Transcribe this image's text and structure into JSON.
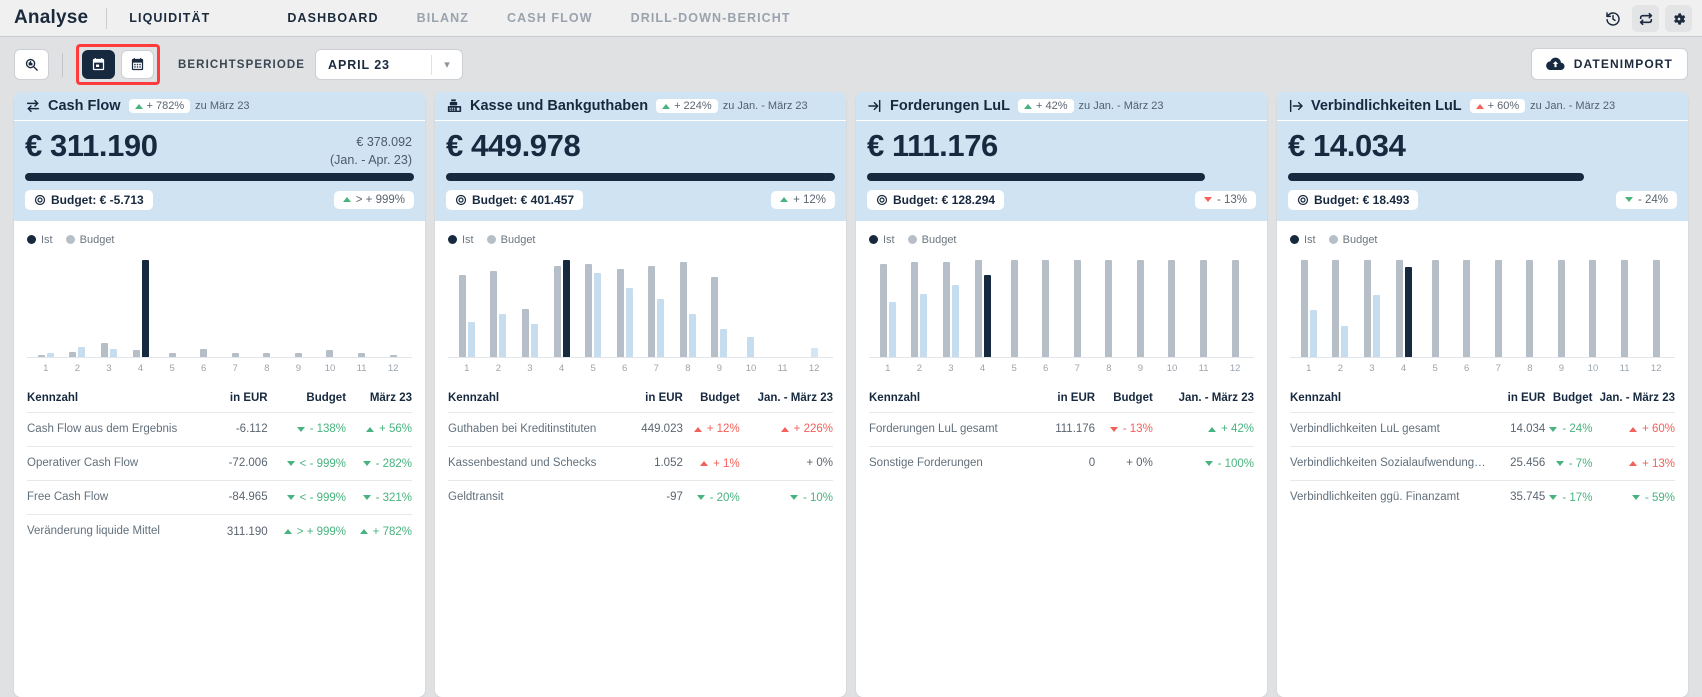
{
  "topbar": {
    "app_title": "Analyse",
    "module": "LIQUIDITÄT",
    "tabs": [
      {
        "label": "DASHBOARD",
        "active": true
      },
      {
        "label": "BILANZ",
        "active": false
      },
      {
        "label": "CASH FLOW",
        "active": false
      },
      {
        "label": "DRILL-DOWN-BERICHT",
        "active": false
      }
    ],
    "icons": [
      "history-icon",
      "refresh-icon",
      "gear-icon"
    ]
  },
  "toolbar": {
    "search_icon": "search-zoom-icon",
    "view_month_icon": "calendar-day-icon",
    "view_year_icon": "calendar-grid-icon",
    "period_label": "BERICHTSPERIODE",
    "period_value": "APRIL 23",
    "import_label": "DATENIMPORT",
    "import_icon": "cloud-upload-icon",
    "highlight_color": "#ff3b3b"
  },
  "table_headers": {
    "kennzahl": "Kennzahl",
    "in_eur": "in EUR",
    "budget": "Budget"
  },
  "cards": [
    {
      "icon": "transfer-arrows-icon",
      "title": "Cash Flow",
      "hdr_delta": "+ 782%",
      "hdr_delta_dir": "up",
      "hdr_note": "zu März 23",
      "big_value": "€ 311.190",
      "sub_value_1": "€ 378.092",
      "sub_value_2": "(Jan. - Apr. 23)",
      "bar_pct": 100,
      "budget_pill": "Budget: € -5.713",
      "delta_pill": "> + 999%",
      "delta_pill_dir": "up",
      "legend": [
        "Ist",
        "Budget"
      ],
      "col4": "März 23",
      "rows": [
        {
          "name": "Cash Flow aus dem Ergebnis",
          "eur": "-6.112",
          "budget": "- 138%",
          "budget_dir": "down",
          "c4": "+ 56%",
          "c4_dir": "up"
        },
        {
          "name": "Operativer Cash Flow",
          "eur": "-72.006",
          "budget": "< - 999%",
          "budget_dir": "down",
          "c4": "- 282%",
          "c4_dir": "down"
        },
        {
          "name": "Free Cash Flow",
          "eur": "-84.965",
          "budget": "< - 999%",
          "budget_dir": "down",
          "c4": "- 321%",
          "c4_dir": "down"
        },
        {
          "name": "Veränderung liquide Mittel",
          "eur": "311.190",
          "budget": "> + 999%",
          "budget_dir": "up",
          "c4": "+ 782%",
          "c4_dir": "up"
        }
      ],
      "chart_data": {
        "type": "bar",
        "title": "Cash Flow",
        "categories": [
          "1",
          "2",
          "3",
          "4",
          "5",
          "6",
          "7",
          "8",
          "9",
          "10",
          "11",
          "12"
        ],
        "series": [
          {
            "name": "Ist",
            "values": [
              2,
              6,
              5,
              62,
              0,
              0,
              0,
              0,
              0,
              0,
              0,
              0
            ]
          },
          {
            "name": "Budget",
            "values": [
              1,
              3,
              9,
              4,
              2,
              5,
              2,
              2,
              2,
              4,
              2,
              1
            ]
          }
        ],
        "ylabel": "",
        "xlabel": "",
        "grid": false,
        "legend_position": "top-left"
      }
    },
    {
      "icon": "cash-register-icon",
      "title": "Kasse und Bankguthaben",
      "hdr_delta": "+ 224%",
      "hdr_delta_dir": "up",
      "hdr_note": "zu Jan. - März 23",
      "big_value": "€ 449.978",
      "sub_value_1": "",
      "sub_value_2": "",
      "bar_pct": 100,
      "budget_pill": "Budget: € 401.457",
      "delta_pill": "+ 12%",
      "delta_pill_dir": "up",
      "legend": [
        "Ist",
        "Budget"
      ],
      "col4": "Jan. - März 23",
      "rows": [
        {
          "name": "Guthaben bei Kreditinstituten",
          "eur": "449.023",
          "budget": "+ 12%",
          "budget_dir": "up-r",
          "c4": "+ 226%",
          "c4_dir": "up-r"
        },
        {
          "name": "Kassenbestand und Schecks",
          "eur": "1.052",
          "budget": "+ 1%",
          "budget_dir": "up-r",
          "c4": "+ 0%",
          "c4_dir": "none"
        },
        {
          "name": "Geldtransit",
          "eur": "-97",
          "budget": "- 20%",
          "budget_dir": "down",
          "c4": "- 10%",
          "c4_dir": "down"
        }
      ],
      "chart_data": {
        "type": "bar",
        "title": "Kasse und Bankguthaben",
        "categories": [
          "1",
          "2",
          "3",
          "4",
          "5",
          "6",
          "7",
          "8",
          "9",
          "10",
          "11",
          "12"
        ],
        "series": [
          {
            "name": "Ist",
            "values": [
              32,
              40,
              30,
              90,
              78,
              64,
              54,
              40,
              26,
              18,
              0,
              -8
            ]
          },
          {
            "name": "Budget",
            "values": [
              76,
              80,
              44,
              84,
              86,
              82,
              84,
              88,
              74,
              0,
              0,
              0
            ]
          }
        ],
        "ylabel": "",
        "xlabel": "",
        "grid": false,
        "legend_position": "top-left"
      }
    },
    {
      "icon": "arrow-into-bracket-icon",
      "title": "Forderungen LuL",
      "hdr_delta": "+ 42%",
      "hdr_delta_dir": "up",
      "hdr_note": "zu Jan. - März 23",
      "big_value": "€ 111.176",
      "sub_value_1": "",
      "sub_value_2": "",
      "bar_pct": 87,
      "budget_pill": "Budget: € 128.294",
      "delta_pill": "- 13%",
      "delta_pill_dir": "down-r",
      "legend": [
        "Ist",
        "Budget"
      ],
      "col4": "Jan. - März 23",
      "rows": [
        {
          "name": "Forderungen LuL gesamt",
          "eur": "111.176",
          "budget": "- 13%",
          "budget_dir": "down-r",
          "c4": "+ 42%",
          "c4_dir": "up"
        },
        {
          "name": "Sonstige Forderungen",
          "eur": "0",
          "budget": "+ 0%",
          "budget_dir": "none",
          "c4": "- 100%",
          "c4_dir": "down"
        }
      ],
      "chart_data": {
        "type": "bar",
        "title": "Forderungen LuL",
        "categories": [
          "1",
          "2",
          "3",
          "4",
          "5",
          "6",
          "7",
          "8",
          "9",
          "10",
          "11",
          "12"
        ],
        "series": [
          {
            "name": "Ist",
            "values": [
              52,
              60,
              68,
              78,
              0,
              0,
              0,
              0,
              0,
              0,
              0,
              0
            ]
          },
          {
            "name": "Budget",
            "values": [
              88,
              90,
              90,
              92,
              92,
              92,
              92,
              92,
              92,
              92,
              92,
              92
            ]
          }
        ],
        "ylabel": "",
        "xlabel": "",
        "grid": false,
        "legend_position": "top-left"
      }
    },
    {
      "icon": "arrow-out-bracket-icon",
      "title": "Verbindlichkeiten LuL",
      "hdr_delta": "+ 60%",
      "hdr_delta_dir": "up-r",
      "hdr_note": "zu Jan. - März 23",
      "big_value": "€ 14.034",
      "sub_value_1": "",
      "sub_value_2": "",
      "bar_pct": 76,
      "budget_pill": "Budget: € 18.493",
      "delta_pill": "- 24%",
      "delta_pill_dir": "down",
      "legend": [
        "Ist",
        "Budget"
      ],
      "col4": "Jan. - März 23",
      "rows": [
        {
          "name": "Verbindlichkeiten LuL gesamt",
          "eur": "14.034",
          "budget": "- 24%",
          "budget_dir": "down",
          "c4": "+ 60%",
          "c4_dir": "up-r"
        },
        {
          "name": "Verbindlichkeiten Sozialaufwendung…",
          "eur": "25.456",
          "budget": "- 7%",
          "budget_dir": "down",
          "c4": "+ 13%",
          "c4_dir": "up-r"
        },
        {
          "name": "Verbindlichkeiten ggü. Finanzamt",
          "eur": "35.745",
          "budget": "- 17%",
          "budget_dir": "down",
          "c4": "- 59%",
          "c4_dir": "down"
        }
      ],
      "chart_data": {
        "type": "bar",
        "title": "Verbindlichkeiten LuL",
        "categories": [
          "1",
          "2",
          "3",
          "4",
          "5",
          "6",
          "7",
          "8",
          "9",
          "10",
          "11",
          "12"
        ],
        "series": [
          {
            "name": "Ist",
            "values": [
              42,
              28,
              56,
              82,
              0,
              0,
              0,
              0,
              0,
              0,
              0,
              0
            ]
          },
          {
            "name": "Budget",
            "values": [
              88,
              88,
              88,
              88,
              88,
              88,
              88,
              88,
              88,
              88,
              88,
              88
            ]
          }
        ],
        "ylabel": "",
        "xlabel": "",
        "grid": false,
        "legend_position": "top-left"
      }
    }
  ]
}
